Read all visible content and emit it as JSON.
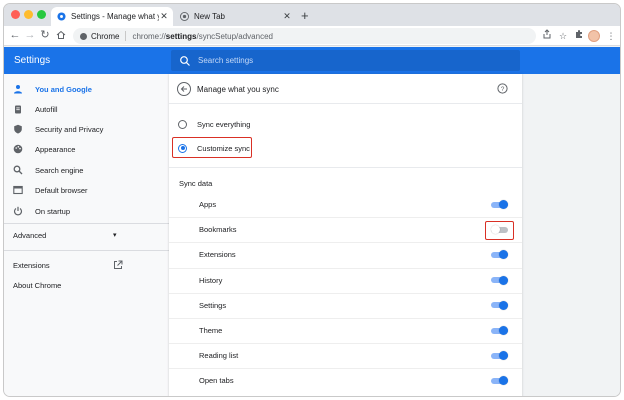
{
  "tabs": [
    {
      "title": "Settings - Manage what you s",
      "icon": "settings-gear-icon",
      "active": true
    },
    {
      "title": "New Tab",
      "icon": "chrome-icon",
      "active": false
    }
  ],
  "omnibox": {
    "chip_label": "Chrome",
    "url_prefix": "chrome://",
    "url_host": "settings",
    "url_path": "/syncSetup/advanced"
  },
  "header": {
    "title": "Settings",
    "search_placeholder": "Search settings"
  },
  "sidebar": {
    "items": [
      {
        "label": "You and Google",
        "icon": "person-icon",
        "selected": true
      },
      {
        "label": "Autofill",
        "icon": "clipboard-icon"
      },
      {
        "label": "Security and Privacy",
        "icon": "shield-icon"
      },
      {
        "label": "Appearance",
        "icon": "palette-icon"
      },
      {
        "label": "Search engine",
        "icon": "search-icon"
      },
      {
        "label": "Default browser",
        "icon": "browser-window-icon"
      },
      {
        "label": "On startup",
        "icon": "power-icon"
      }
    ],
    "advanced_label": "Advanced",
    "extensions_label": "Extensions",
    "about_label": "About Chrome"
  },
  "main": {
    "page_title": "Manage what you sync",
    "sync_everything_label": "Sync everything",
    "customize_sync_label": "Customize sync",
    "sync_mode": "customize",
    "section_label": "Sync data",
    "items": [
      {
        "label": "Apps",
        "enabled": true
      },
      {
        "label": "Bookmarks",
        "enabled": false
      },
      {
        "label": "Extensions",
        "enabled": true
      },
      {
        "label": "History",
        "enabled": true
      },
      {
        "label": "Settings",
        "enabled": true
      },
      {
        "label": "Theme",
        "enabled": true
      },
      {
        "label": "Reading list",
        "enabled": true
      },
      {
        "label": "Open tabs",
        "enabled": true
      }
    ]
  },
  "colors": {
    "accent": "#1a73e8",
    "highlight": "#d93025"
  }
}
